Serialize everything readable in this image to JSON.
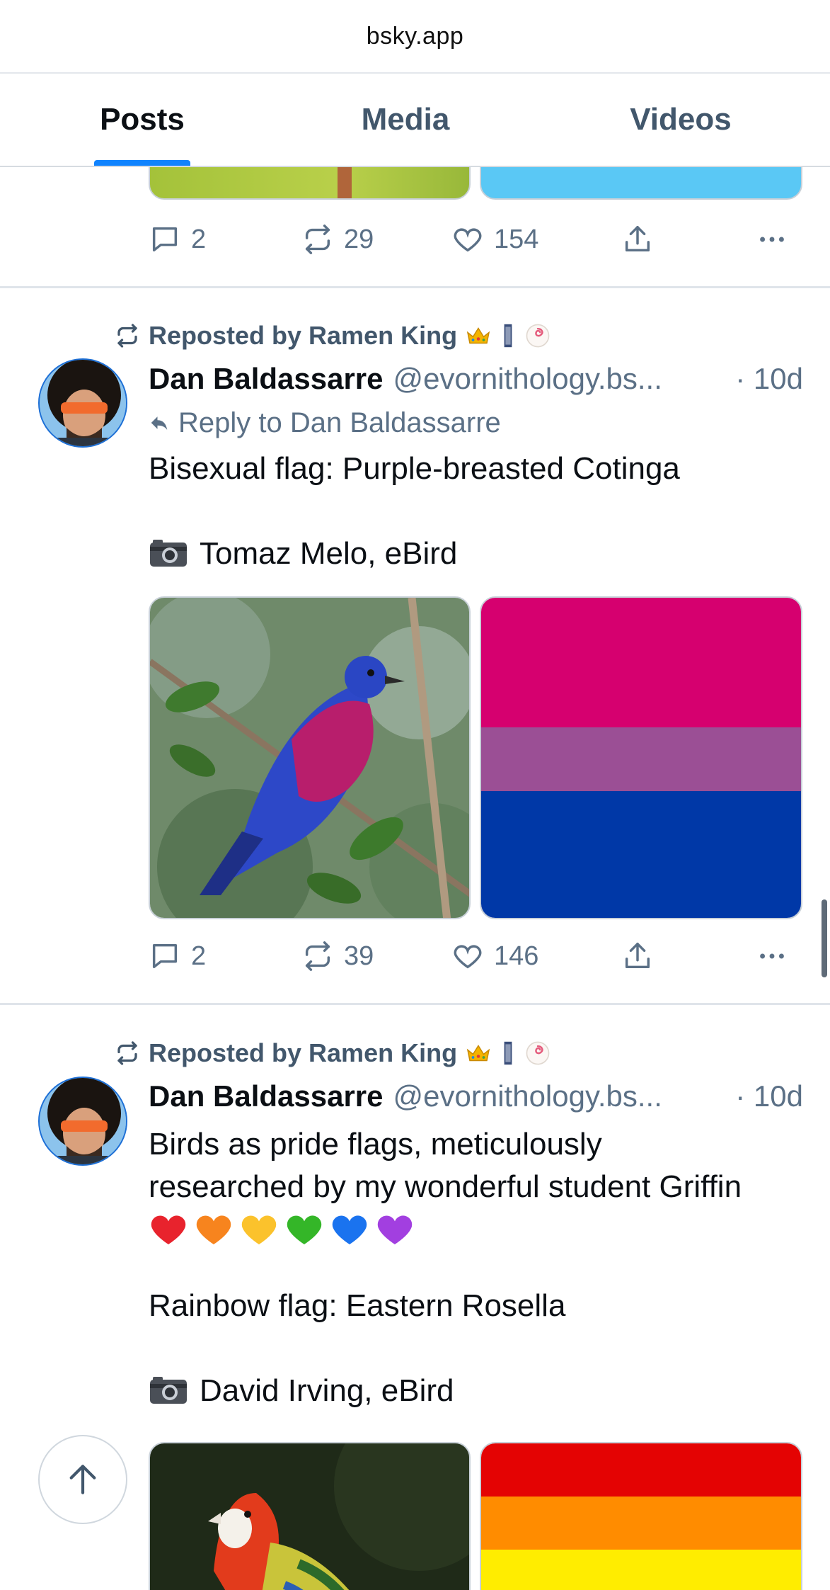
{
  "url": "bsky.app",
  "tabs": [
    {
      "label": "Posts",
      "active": true
    },
    {
      "label": "Media",
      "active": false
    },
    {
      "label": "Videos",
      "active": false
    }
  ],
  "post0": {
    "actions": {
      "replies": "2",
      "reposts": "29",
      "likes": "154"
    }
  },
  "post1": {
    "repost_by": "Reposted by Ramen King",
    "author": "Dan Baldassarre",
    "handle": "@evornithology.bs...",
    "time": "· 10d",
    "reply_to": "Reply to Dan Baldassarre",
    "text_line1": "Bisexual flag: Purple-breasted Cotinga",
    "credit": "Tomaz Melo, eBird",
    "flag_colors": [
      "#d6006f",
      "#9b4f95",
      "#0038a7"
    ],
    "actions": {
      "replies": "2",
      "reposts": "39",
      "likes": "146"
    }
  },
  "post2": {
    "repost_by": "Reposted by Ramen King",
    "author": "Dan Baldassarre",
    "handle": "@evornithology.bs...",
    "time": "· 10d",
    "text_line1": "Birds as pride flags, meticulously",
    "text_line2": "researched by my wonderful student Griffin",
    "hearts": [
      "red-heart",
      "orange-heart",
      "yellow-heart",
      "green-heart",
      "blue-heart",
      "purple-heart"
    ],
    "text_line3": "Rainbow flag: Eastern Rosella",
    "credit": "David Irving, eBird",
    "flag_colors": [
      "#e40303",
      "#ff8c00",
      "#ffed00"
    ]
  },
  "colors": {
    "accent": "#1083fe",
    "muted": "#5b7086"
  }
}
